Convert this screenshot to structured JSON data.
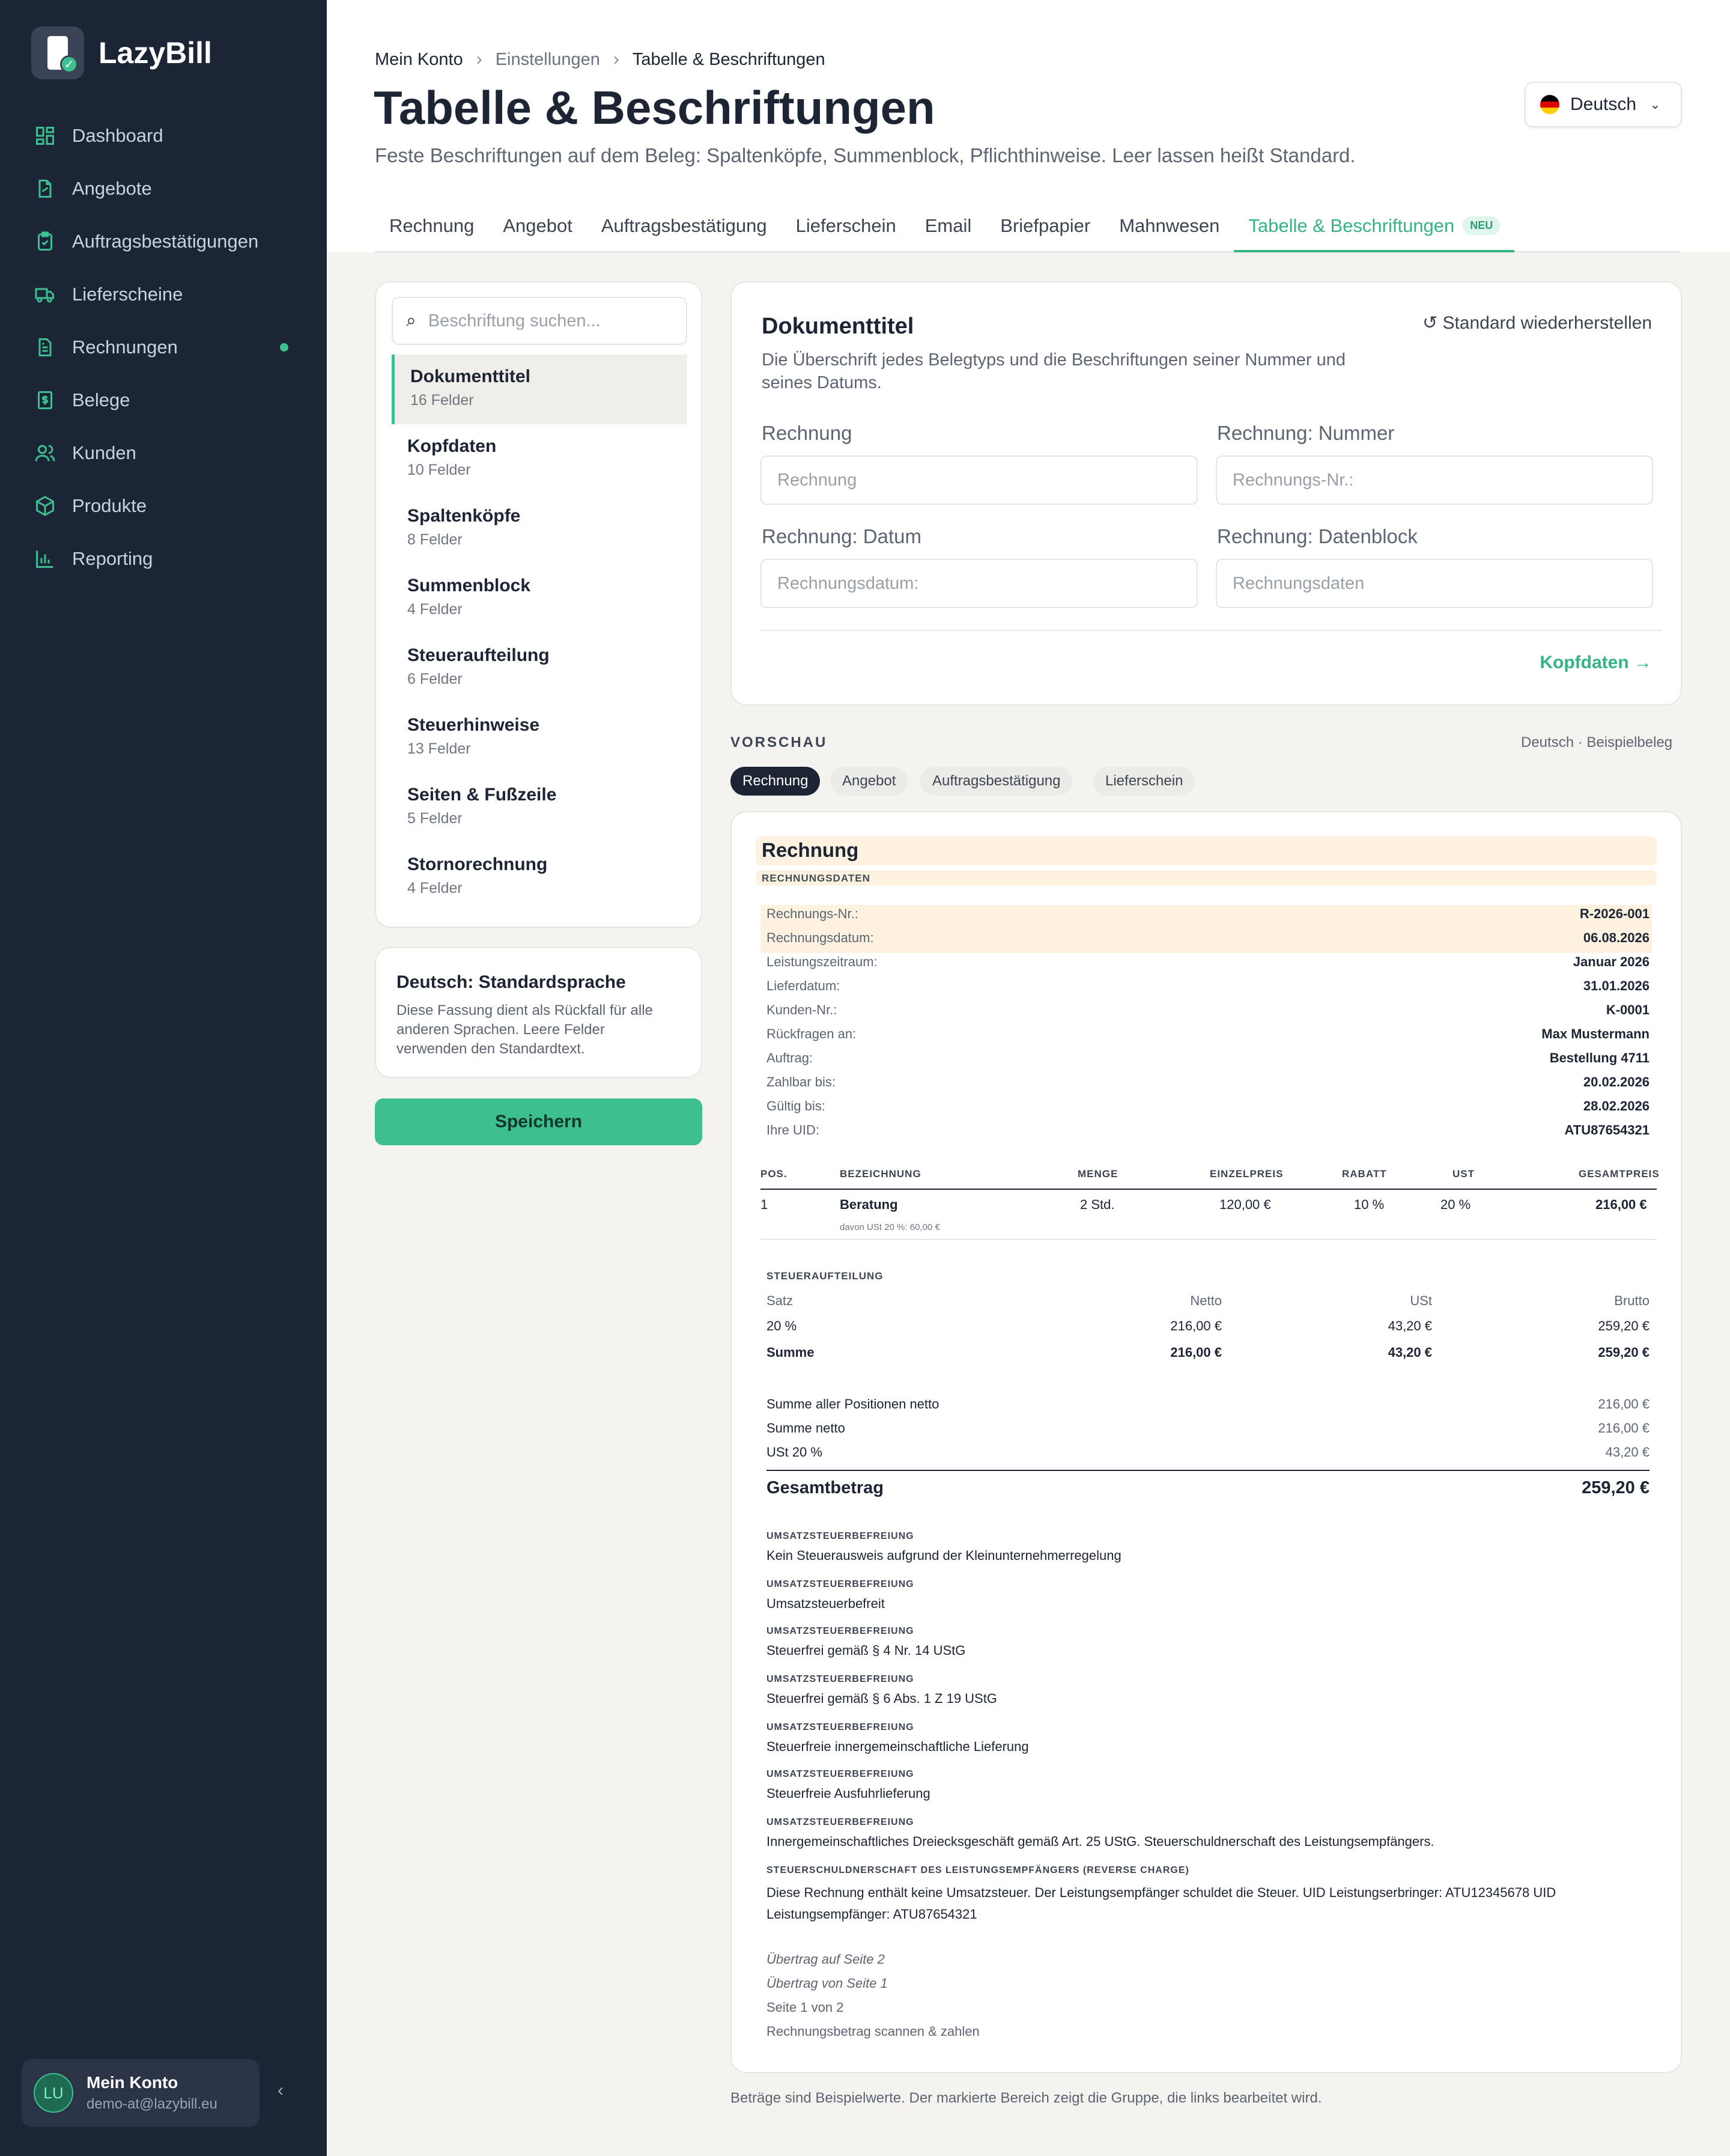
{
  "app": {
    "name": "LazyBill"
  },
  "sidebar": {
    "items": [
      {
        "label": "Dashboard",
        "icon": "dashboard-icon"
      },
      {
        "label": "Angebote",
        "icon": "offer-icon"
      },
      {
        "label": "Auftragsbestätigungen",
        "icon": "clipboard-check-icon"
      },
      {
        "label": "Lieferscheine",
        "icon": "truck-icon"
      },
      {
        "label": "Rechnungen",
        "icon": "invoice-icon",
        "dot": true
      },
      {
        "label": "Belege",
        "icon": "receipt-icon"
      },
      {
        "label": "Kunden",
        "icon": "users-icon"
      },
      {
        "label": "Produkte",
        "icon": "box-icon"
      },
      {
        "label": "Reporting",
        "icon": "chart-icon"
      }
    ],
    "account": {
      "initials": "LU",
      "name": "Mein Konto",
      "email": "demo-at@lazybill.eu"
    }
  },
  "breadcrumb": [
    "Mein Konto",
    "Einstellungen",
    "Tabelle & Beschriftungen"
  ],
  "page": {
    "title": "Tabelle & Beschriftungen",
    "subtitle": "Feste Beschriftungen auf dem Beleg: Spaltenköpfe, Summenblock, Pflichthinweise. Leer lassen heißt Standard."
  },
  "language": {
    "selected": "Deutsch"
  },
  "tabs": [
    {
      "label": "Rechnung"
    },
    {
      "label": "Angebot"
    },
    {
      "label": "Auftragsbestätigung"
    },
    {
      "label": "Lieferschein"
    },
    {
      "label": "Email"
    },
    {
      "label": "Briefpapier"
    },
    {
      "label": "Mahnwesen"
    },
    {
      "label": "Tabelle & Beschriftungen",
      "badge": "NEU",
      "active": true
    }
  ],
  "groups": {
    "search_placeholder": "Beschriftung suchen...",
    "items": [
      {
        "title": "Dokumenttitel",
        "count": "16 Felder"
      },
      {
        "title": "Kopfdaten",
        "count": "10 Felder"
      },
      {
        "title": "Spaltenköpfe",
        "count": "8 Felder"
      },
      {
        "title": "Summenblock",
        "count": "4 Felder"
      },
      {
        "title": "Steueraufteilung",
        "count": "6 Felder"
      },
      {
        "title": "Steuerhinweise",
        "count": "13 Felder"
      },
      {
        "title": "Seiten & Fußzeile",
        "count": "5 Felder"
      },
      {
        "title": "Stornorechnung",
        "count": "4 Felder"
      }
    ]
  },
  "info": {
    "title": "Deutsch: Standardsprache",
    "text": "Diese Fassung dient als Rückfall für alle anderen Sprachen. Leere Felder verwenden den Standardtext."
  },
  "save_label": "Speichern",
  "editor": {
    "title": "Dokumenttitel",
    "description": "Die Überschrift jedes Belegtyps und die Beschriftungen seiner Nummer und seines Datums.",
    "restore_label": "Standard wiederherstellen",
    "fields": [
      {
        "label": "Rechnung",
        "placeholder": "Rechnung"
      },
      {
        "label": "Rechnung: Nummer",
        "placeholder": "Rechnungs-Nr.:"
      },
      {
        "label": "Rechnung: Datum",
        "placeholder": "Rechnungsdatum:"
      },
      {
        "label": "Rechnung: Datenblock",
        "placeholder": "Rechnungsdaten"
      }
    ],
    "next_link": "Kopfdaten →"
  },
  "preview": {
    "label": "VORSCHAU",
    "meta": "Deutsch · Beispielbeleg",
    "chips": [
      "Rechnung",
      "Angebot",
      "Auftragsbestätigung",
      "Lieferschein"
    ],
    "doc": {
      "title": "Rechnung",
      "subtitle": "RECHNUNGSDATEN",
      "fields": [
        {
          "k": "Rechnungs-Nr.:",
          "v": "R-2026-001"
        },
        {
          "k": "Rechnungsdatum:",
          "v": "06.08.2026"
        },
        {
          "k": "Leistungszeitraum:",
          "v": "Januar 2026"
        },
        {
          "k": "Lieferdatum:",
          "v": "31.01.2026"
        },
        {
          "k": "Kunden-Nr.:",
          "v": "K-0001"
        },
        {
          "k": "Rückfragen an:",
          "v": "Max Mustermann"
        },
        {
          "k": "Auftrag:",
          "v": "Bestellung 4711"
        },
        {
          "k": "Zahlbar bis:",
          "v": "20.02.2026"
        },
        {
          "k": "Gültig bis:",
          "v": "28.02.2026"
        },
        {
          "k": "Ihre UID:",
          "v": "ATU87654321"
        }
      ],
      "table": {
        "headers": [
          "POS.",
          "BEZEICHNUNG",
          "MENGE",
          "EINZELPREIS",
          "RABATT",
          "UST",
          "GESAMTPREIS"
        ],
        "row": [
          "1",
          "Beratung",
          "2 Std.",
          "120,00 €",
          "10 %",
          "20 %",
          "216,00 €"
        ],
        "row_note": "davon USt 20 %: 60,00 €"
      },
      "tax": {
        "title": "STEUERAUFTEILUNG",
        "headers": [
          "Satz",
          "Netto",
          "USt",
          "Brutto"
        ],
        "row": [
          "20 %",
          "216,00 €",
          "43,20 €",
          "259,20 €"
        ],
        "sum": [
          "Summe",
          "216,00 €",
          "43,20 €",
          "259,20 €"
        ]
      },
      "totals": [
        {
          "k": "Summe aller Positionen netto",
          "v": "216,00 €"
        },
        {
          "k": "Summe netto",
          "v": "216,00 €"
        },
        {
          "k": "USt 20 %",
          "v": "43,20 €"
        }
      ],
      "grand": {
        "k": "Gesamtbetrag",
        "v": "259,20 €"
      },
      "notes": [
        {
          "t": "UMSATZSTEUERBEFREIUNG",
          "b": "Kein Steuerausweis aufgrund der Kleinunternehmerregelung"
        },
        {
          "t": "UMSATZSTEUERBEFREIUNG",
          "b": "Umsatzsteuerbefreit"
        },
        {
          "t": "UMSATZSTEUERBEFREIUNG",
          "b": "Steuerfrei gemäß § 4 Nr. 14 UStG"
        },
        {
          "t": "UMSATZSTEUERBEFREIUNG",
          "b": "Steuerfrei gemäß § 6 Abs. 1 Z 19 UStG"
        },
        {
          "t": "UMSATZSTEUERBEFREIUNG",
          "b": "Steuerfreie innergemeinschaftliche Lieferung"
        },
        {
          "t": "UMSATZSTEUERBEFREIUNG",
          "b": "Steuerfreie Ausfuhrlieferung"
        },
        {
          "t": "UMSATZSTEUERBEFREIUNG",
          "b": "Innergemeinschaftliches Dreiecksgeschäft gemäß Art. 25 UStG. Steuerschuldnerschaft des Leistungsempfängers."
        },
        {
          "t": "STEUERSCHULDNERSCHAFT DES LEISTUNGSEMPFÄNGERS (REVERSE CHARGE)",
          "b": "Diese Rechnung enthält keine Umsatzsteuer. Der Leistungsempfänger schuldet die Steuer. UID Leistungserbringer: ATU12345678 UID Leistungsempfänger: ATU87654321"
        }
      ],
      "footer": [
        "Übertrag auf Seite 2",
        "Übertrag von Seite 1",
        "Seite 1 von 2",
        "Rechnungsbetrag scannen & zahlen"
      ]
    },
    "footnote": "Beträge sind Beispielwerte. Der markierte Bereich zeigt die Gruppe, die links bearbeitet wird."
  },
  "colors": {
    "accent": "#3ebf8f",
    "sidebar": "#1c2536",
    "highlight": "#fdf1e0"
  }
}
